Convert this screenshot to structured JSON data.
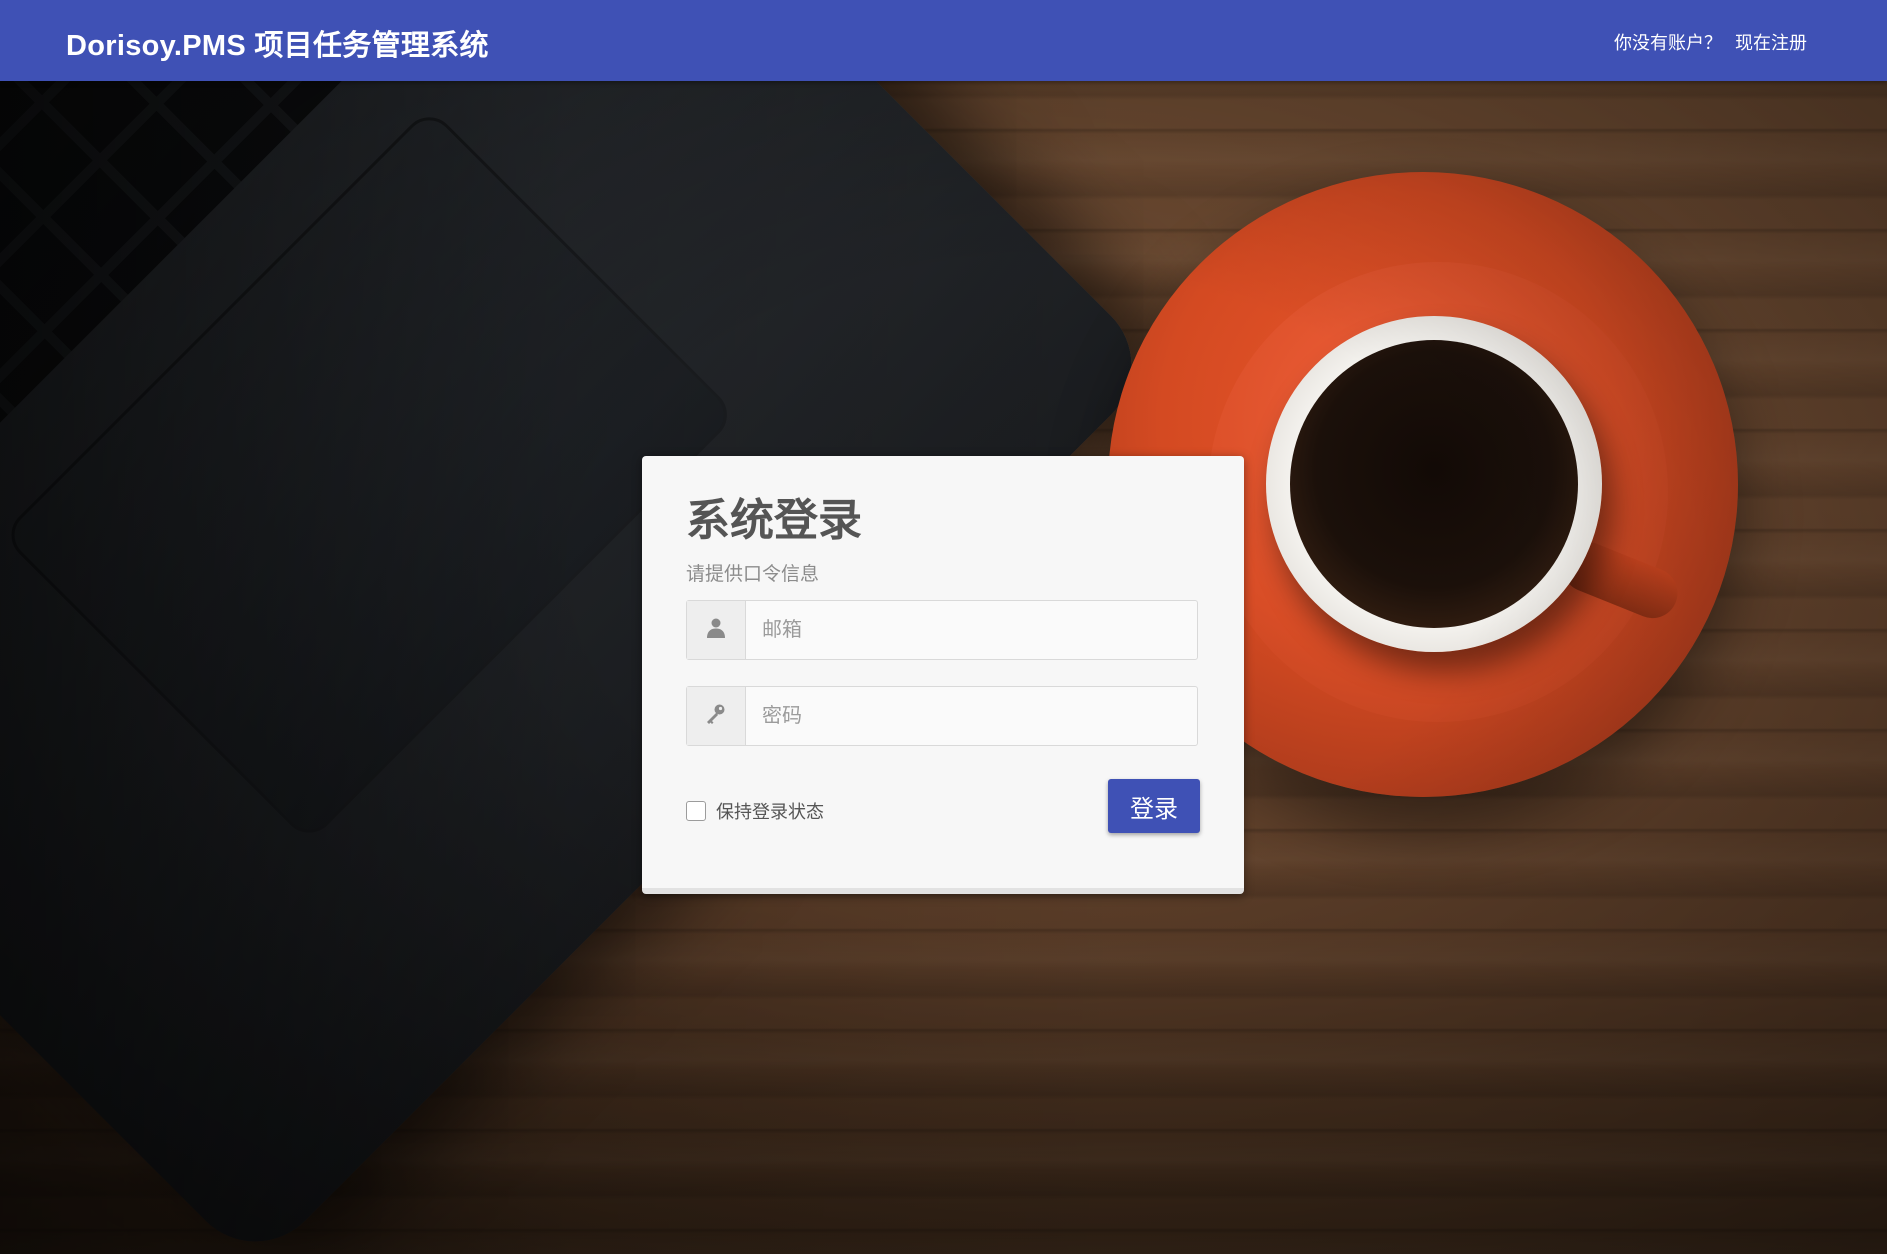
{
  "navbar": {
    "brand": "Dorisoy.PMS 项目任务管理系统",
    "no_account_text": "你没有账户？",
    "register_link": "现在注册"
  },
  "login": {
    "title": "系统登录",
    "subtitle": "请提供口令信息",
    "email_placeholder": "邮箱",
    "email_value": "",
    "password_placeholder": "密码",
    "password_value": "",
    "remember_label": "保持登录状态",
    "remember_checked": false,
    "submit_label": "登录"
  },
  "icons": {
    "email_addon": "user-icon",
    "password_addon": "key-icon"
  },
  "colors": {
    "primary": "#3f51b5",
    "card_bg": "#f7f7f7",
    "title_text": "#555555"
  }
}
